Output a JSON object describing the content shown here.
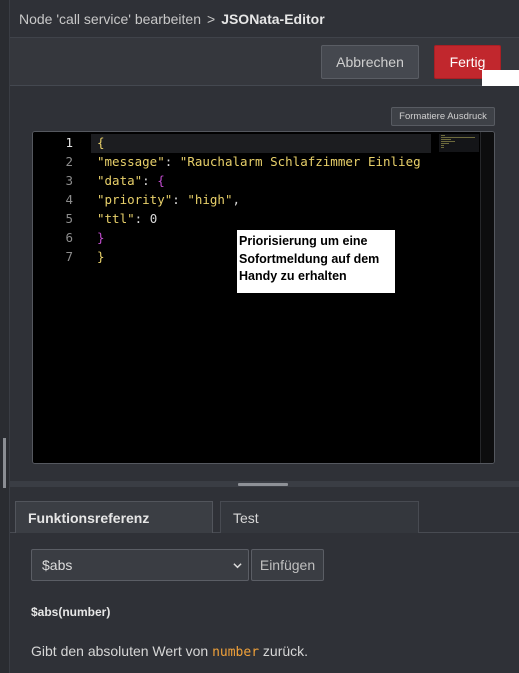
{
  "header": {
    "breadcrumb": "Node 'call service' bearbeiten",
    "separator": ">",
    "title": "JSONata-Editor"
  },
  "toolbar": {
    "cancel_label": "Abbrechen",
    "done_label": "Fertig",
    "done_color": "#c1272d"
  },
  "editor": {
    "format_label": "Formatiere Ausdruck",
    "line_numbers": [
      "1",
      "2",
      "3",
      "4",
      "5",
      "6",
      "7"
    ],
    "lines": {
      "l1": {
        "brace": "{"
      },
      "l2": {
        "key": "\"message\"",
        "colon": ": ",
        "value": "\"Rauchalarm Schlafzimmer Einlieg"
      },
      "l3": {
        "key": "\"data\"",
        "colon": ": ",
        "brace": "{"
      },
      "l4": {
        "key": "\"priority\"",
        "colon": ": ",
        "value": "\"high\"",
        "comma": ","
      },
      "l5": {
        "key": "\"ttl\"",
        "colon": ": ",
        "value": "0"
      },
      "l6": {
        "brace": "}"
      },
      "l7": {
        "brace": "}"
      }
    },
    "annotation": "Priorisierung um eine Sofortmeldung auf dem Handy zu erhalten"
  },
  "bottom": {
    "tabs": [
      "Funktionsreferenz",
      "Test"
    ],
    "function_select_value": "$abs",
    "insert_label": "Einfügen",
    "signature": "$abs(number)",
    "description_before": "Gibt den absoluten Wert von ",
    "description_code": "number",
    "description_after": " zurück."
  }
}
